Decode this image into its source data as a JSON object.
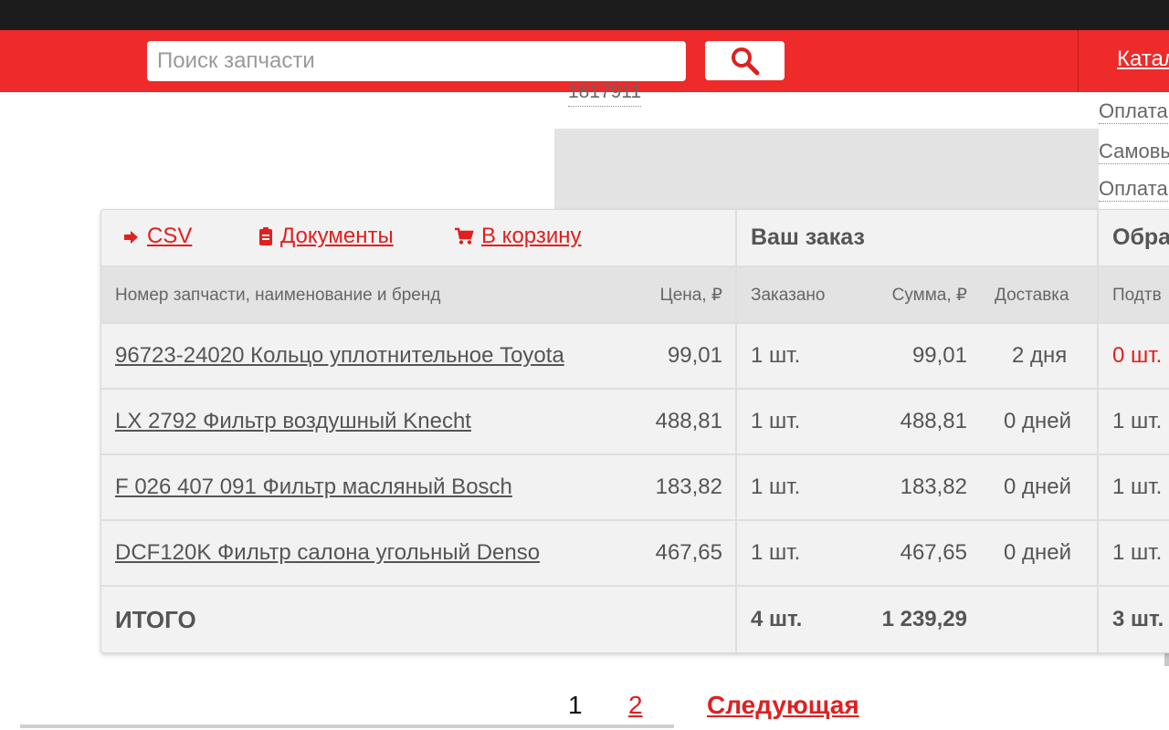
{
  "header": {
    "search_placeholder": "Поиск запчасти",
    "catalog_link": "Катал"
  },
  "background": {
    "partial_number": "1817911",
    "side_links": [
      "Оплата",
      "Самовы",
      "Оплата"
    ]
  },
  "order": {
    "actions": [
      {
        "label": "CSV",
        "icon": "csv-export-icon"
      },
      {
        "label": "Документы",
        "icon": "document-icon"
      },
      {
        "label": "В корзину",
        "icon": "cart-icon"
      }
    ],
    "section_titles": {
      "your_order": "Ваш заказ",
      "processing": "Обра"
    },
    "columns": {
      "part": "Номер запчасти, наименование и бренд",
      "price": "Цена, ₽",
      "ordered": "Заказано",
      "sum": "Сумма, ₽",
      "delivery": "Доставка",
      "confirmed": "Подтв"
    },
    "rows": [
      {
        "part": "96723-24020  Кольцо уплотнительное  Toyota",
        "price": "99,01",
        "ordered": "1 шт.",
        "sum": "99,01",
        "delivery": "2 дня",
        "confirmed": "0 шт."
      },
      {
        "part": "LX 2792  Фильтр воздушный  Knecht",
        "price": "488,81",
        "ordered": "1 шт.",
        "sum": "488,81",
        "delivery": "0 дней",
        "confirmed": "1 шт."
      },
      {
        "part": "F 026 407 091  Фильтр масляный  Bosch",
        "price": "183,82",
        "ordered": "1 шт.",
        "sum": "183,82",
        "delivery": "0 дней",
        "confirmed": "1 шт."
      },
      {
        "part": "DCF120K  Фильтр салона угольный  Denso",
        "price": "467,65",
        "ordered": "1 шт.",
        "sum": "467,65",
        "delivery": "0 дней",
        "confirmed": "1 шт."
      }
    ],
    "total": {
      "label": "ИТОГО",
      "ordered": "4 шт.",
      "sum": "1 239,29",
      "confirmed": "3 шт."
    }
  },
  "pagination": {
    "current": "1",
    "next_page": "2",
    "next_label": "Следующая"
  },
  "colors": {
    "brand_red": "#ee2a2a",
    "link_red": "#e02020",
    "warning_red": "#e51c1c",
    "top_bar": "#1c1c1c"
  }
}
